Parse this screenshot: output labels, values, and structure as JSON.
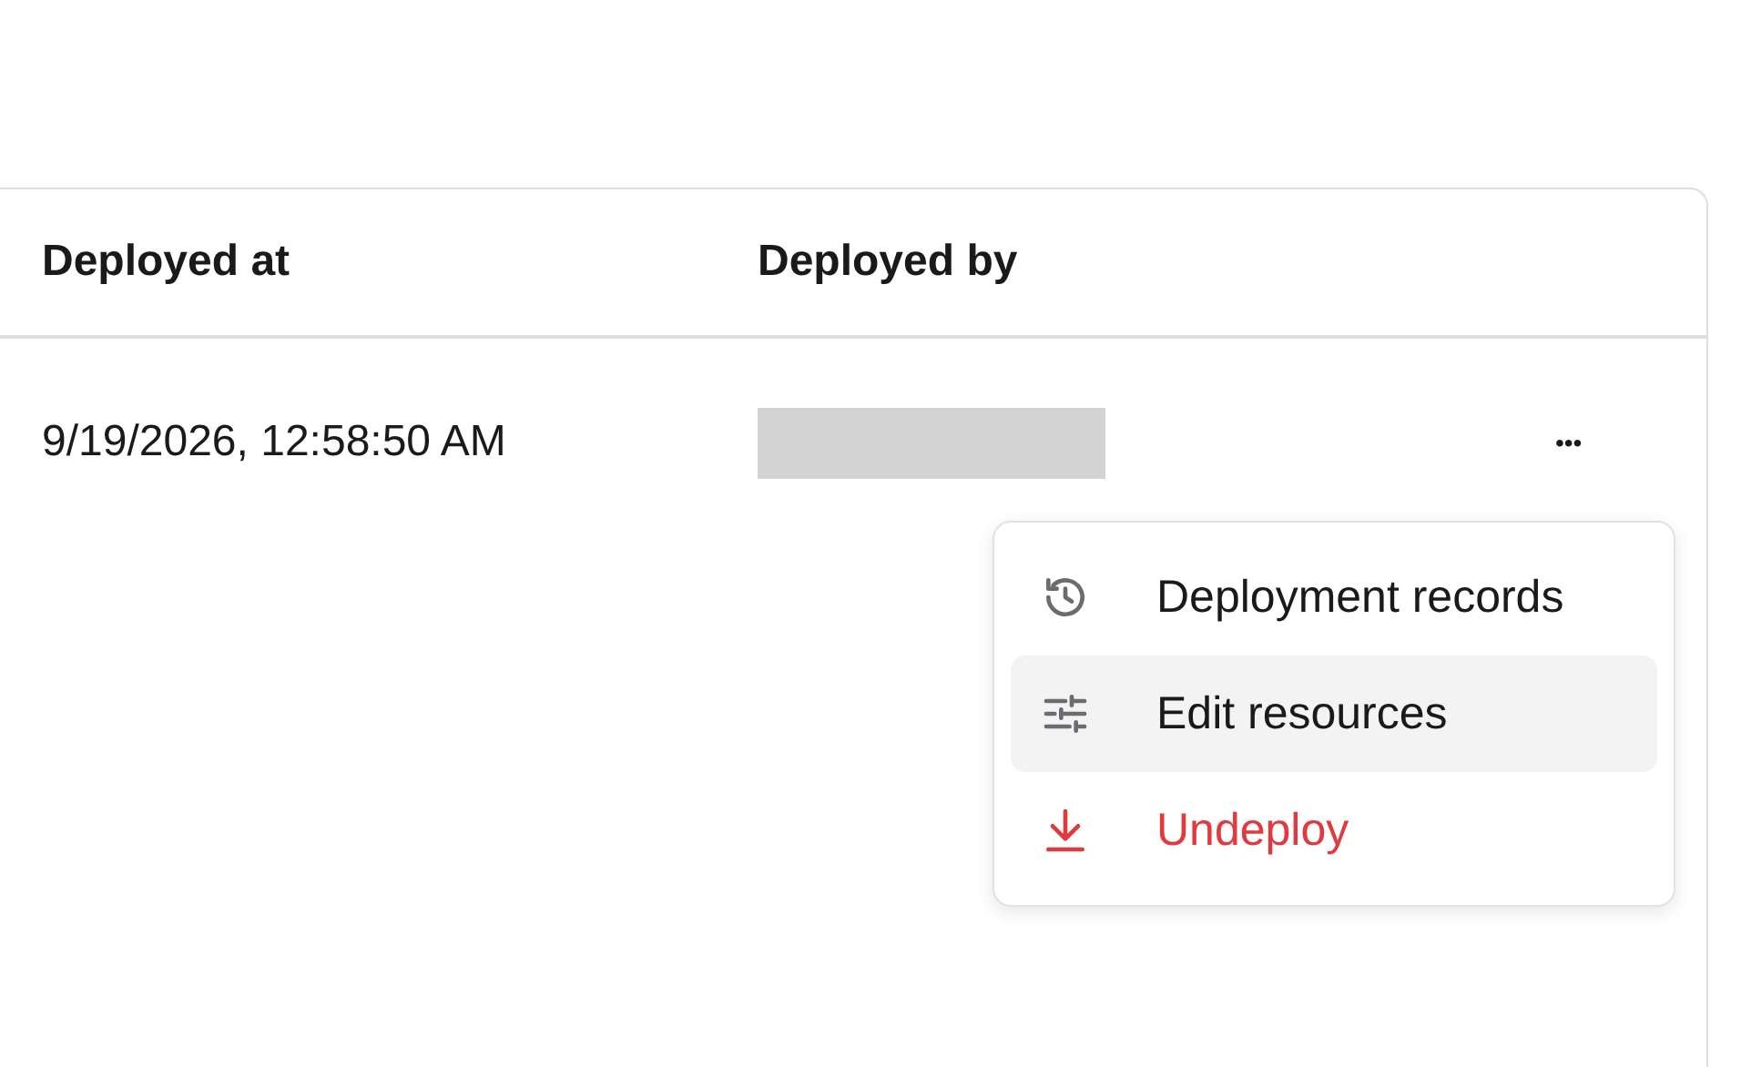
{
  "table": {
    "columns": [
      "Deployed at",
      "Deployed by"
    ],
    "rows": [
      {
        "deployed_at": "9/19/2026, 12:58:50 AM",
        "actions": "•••"
      }
    ]
  },
  "menu": {
    "items": [
      {
        "label": "Deployment records",
        "kind": "default",
        "selected": false
      },
      {
        "label": "Edit resources",
        "kind": "default",
        "selected": true
      },
      {
        "label": "Undeploy",
        "kind": "danger",
        "selected": false
      }
    ]
  }
}
